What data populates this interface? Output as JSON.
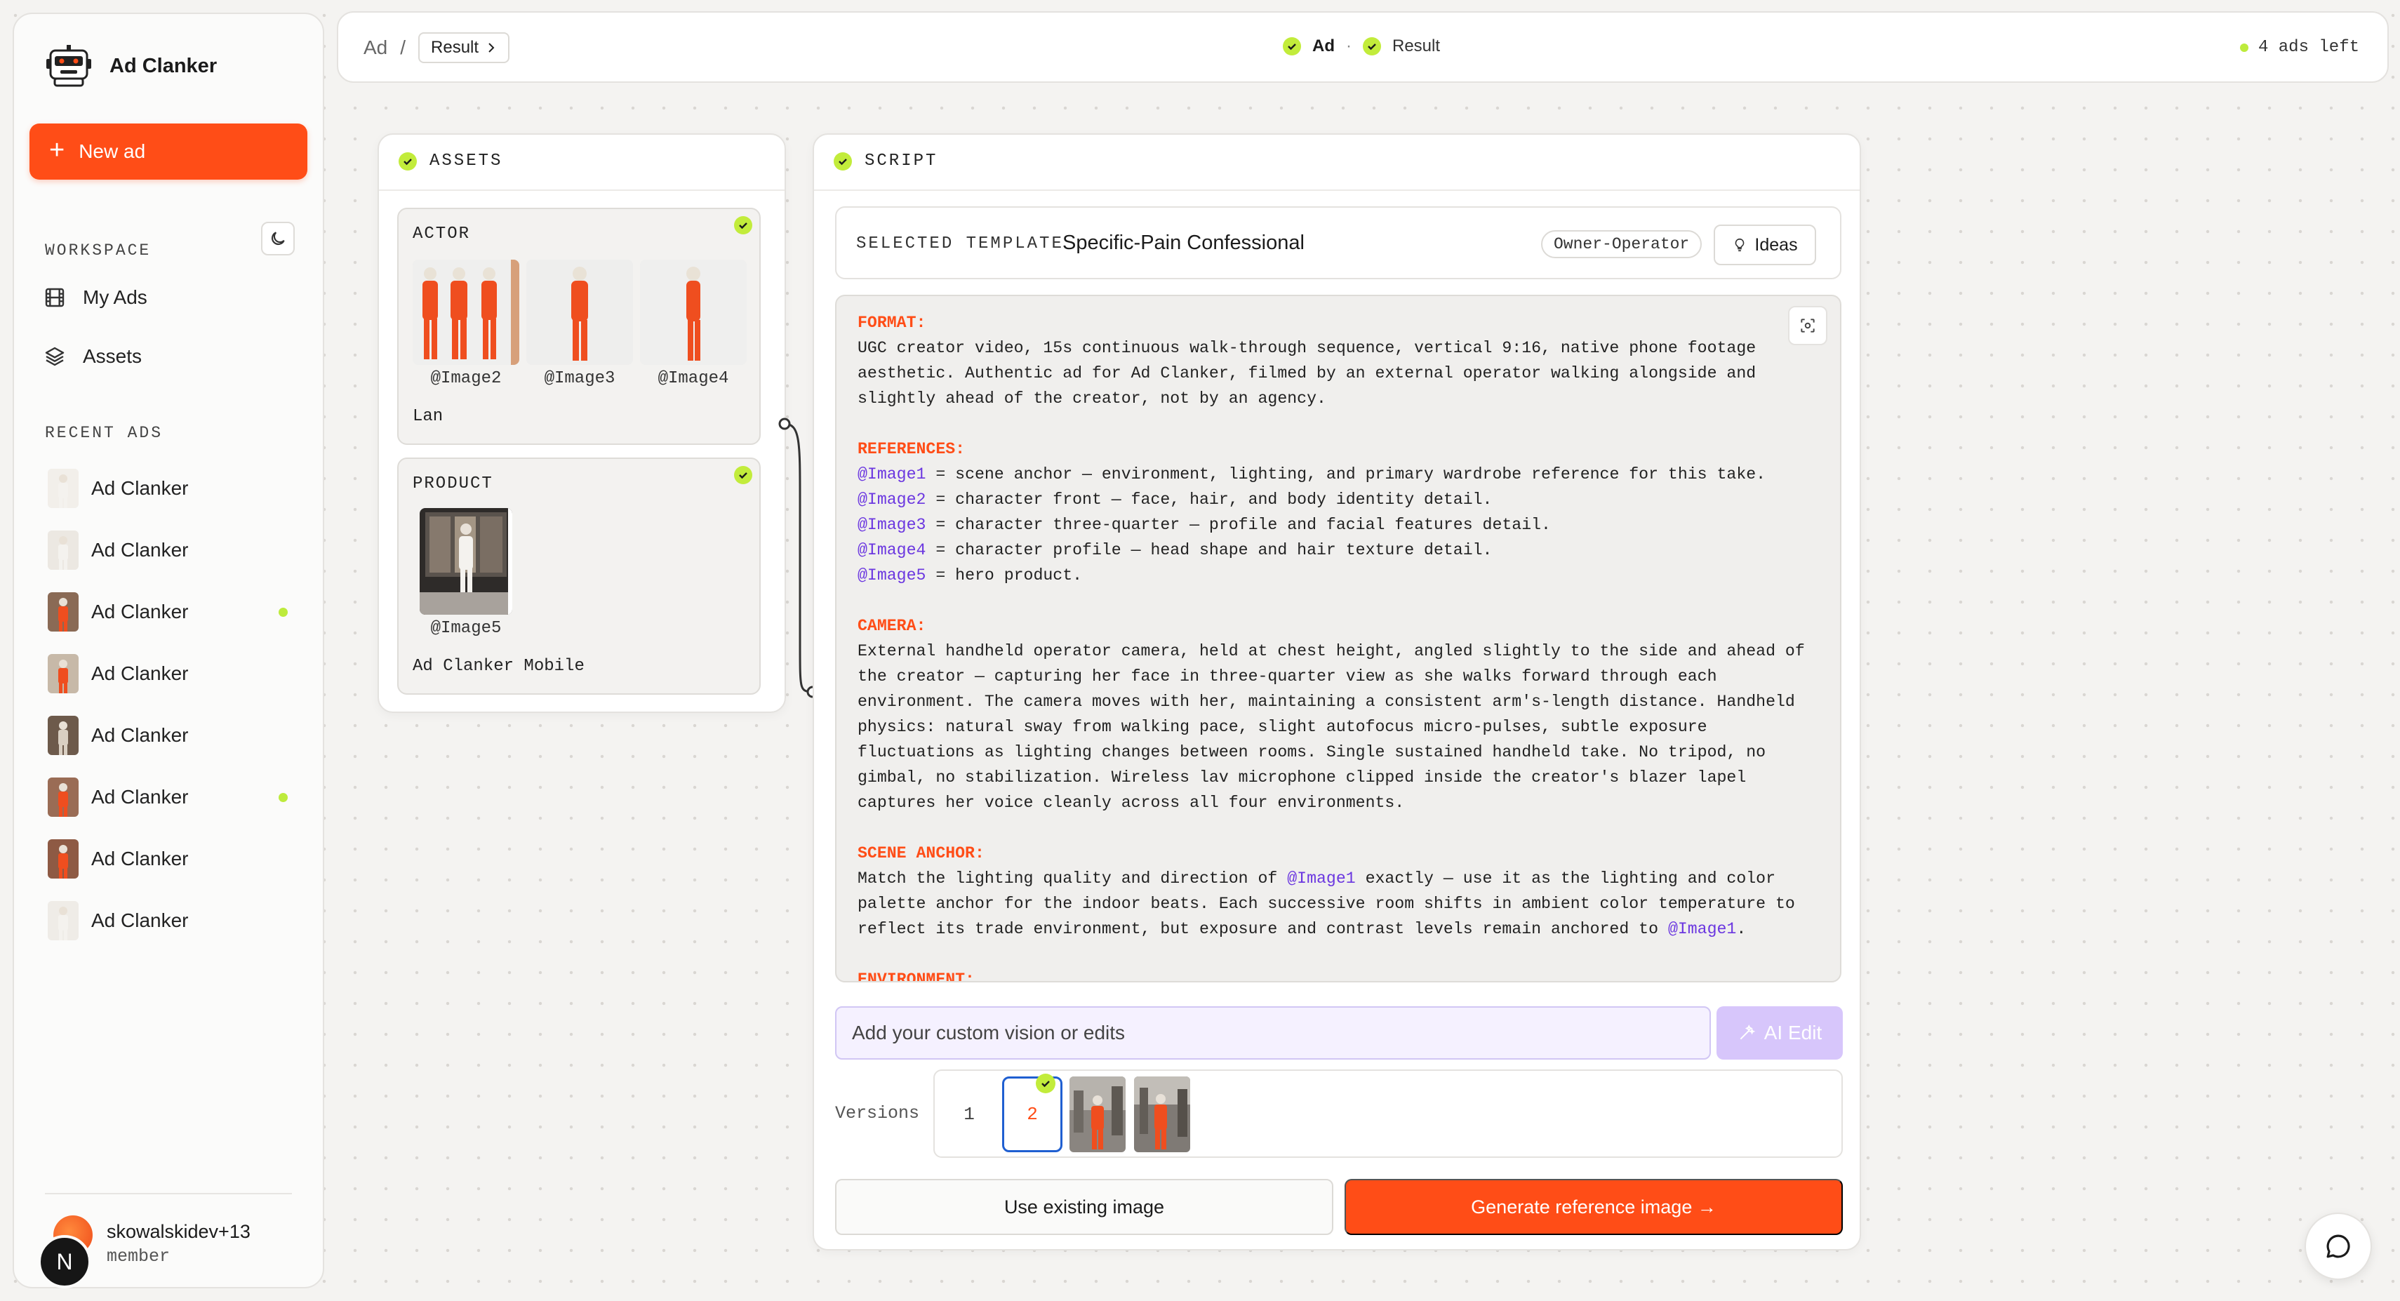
{
  "brand": {
    "name": "Ad Clanker",
    "icon": "robot-logo-icon"
  },
  "sidebar": {
    "new_ad_label": "New ad",
    "workspace_label": "WORKSPACE",
    "nav": [
      {
        "label": "My Ads",
        "icon": "film-icon"
      },
      {
        "label": "Assets",
        "icon": "layers-icon"
      }
    ],
    "recent_label": "RECENT ADS",
    "recent": [
      {
        "label": "Ad Clanker",
        "status": false
      },
      {
        "label": "Ad Clanker",
        "status": false
      },
      {
        "label": "Ad Clanker",
        "status": true
      },
      {
        "label": "Ad Clanker",
        "status": false
      },
      {
        "label": "Ad Clanker",
        "status": false
      },
      {
        "label": "Ad Clanker",
        "status": true
      },
      {
        "label": "Ad Clanker",
        "status": false
      },
      {
        "label": "Ad Clanker",
        "status": false
      }
    ],
    "user": {
      "name": "skowalskidev+13",
      "role": "member",
      "avatar_letter": "N"
    }
  },
  "header": {
    "breadcrumb_root": "Ad",
    "breadcrumb_sep": "/",
    "breadcrumb_current": "Result",
    "steps": [
      "Ad",
      "Result"
    ],
    "step_sep": "·",
    "ads_left": "4 ads left"
  },
  "assets": {
    "title": "ASSETS",
    "actor": {
      "label": "ACTOR",
      "images": [
        "@Image2",
        "@Image3",
        "@Image4"
      ],
      "name": "Lan"
    },
    "product": {
      "label": "PRODUCT",
      "images": [
        "@Image5"
      ],
      "name": "Ad Clanker Mobile"
    }
  },
  "script": {
    "title": "SCRIPT",
    "template_label": "SELECTED TEMPLATE",
    "template_name": "Specific-Pain Confessional",
    "template_tag": "Owner-Operator",
    "ideas_label": "Ideas",
    "sections": {
      "format_h": "FORMAT:",
      "format": "UGC creator video, 15s continuous walk-through sequence, vertical 9:16, native phone footage aesthetic. Authentic ad for Ad Clanker, filmed by an external operator walking alongside and slightly ahead of the creator, not by an agency.",
      "references_h": "REFERENCES:",
      "references": [
        {
          "ref": "@Image1",
          "text": " = scene anchor — environment, lighting, and primary wardrobe reference for this take."
        },
        {
          "ref": "@Image2",
          "text": " = character front — face, hair, and body identity detail."
        },
        {
          "ref": "@Image3",
          "text": " = character three-quarter — profile and facial features detail."
        },
        {
          "ref": "@Image4",
          "text": " = character profile — head shape and hair texture detail."
        },
        {
          "ref": "@Image5",
          "text": " = hero product."
        }
      ],
      "camera_h": "CAMERA:",
      "camera": "External handheld operator camera, held at chest height, angled slightly to the side and ahead of the creator — capturing her face in three-quarter view as she walks forward through each environment. The camera moves with her, maintaining a consistent arm's-length distance. Handheld physics: natural sway from walking pace, slight autofocus micro-pulses, subtle exposure fluctuations as lighting changes between rooms. Single sustained handheld take. No tripod, no gimbal, no stabilization. Wireless lav microphone clipped inside the creator's blazer lapel captures her voice cleanly across all four environments.",
      "scene_h": "SCENE ANCHOR:",
      "scene_1": "Match the lighting quality and direction of ",
      "scene_ref1": "@Image1",
      "scene_2": " exactly — use it as the lighting and color palette anchor for the indoor beats. Each successive room shifts in ambient color temperature to reflect its trade environment, but exposure and contrast levels remain anchored to ",
      "scene_ref2": "@Image1",
      "scene_3": ".",
      "env_h": "ENVIRONMENT:"
    },
    "edit_placeholder": "Add your custom vision or edits",
    "ai_edit_label": "AI Edit",
    "versions_label": "Versions",
    "versions": [
      "1",
      "2"
    ],
    "use_existing_label": "Use existing image",
    "generate_label": "Generate reference image →"
  },
  "colors": {
    "accent": "#ff4d17",
    "check": "#c2ec3b",
    "ref": "#6b37e0",
    "selected": "#1f5fd1"
  }
}
